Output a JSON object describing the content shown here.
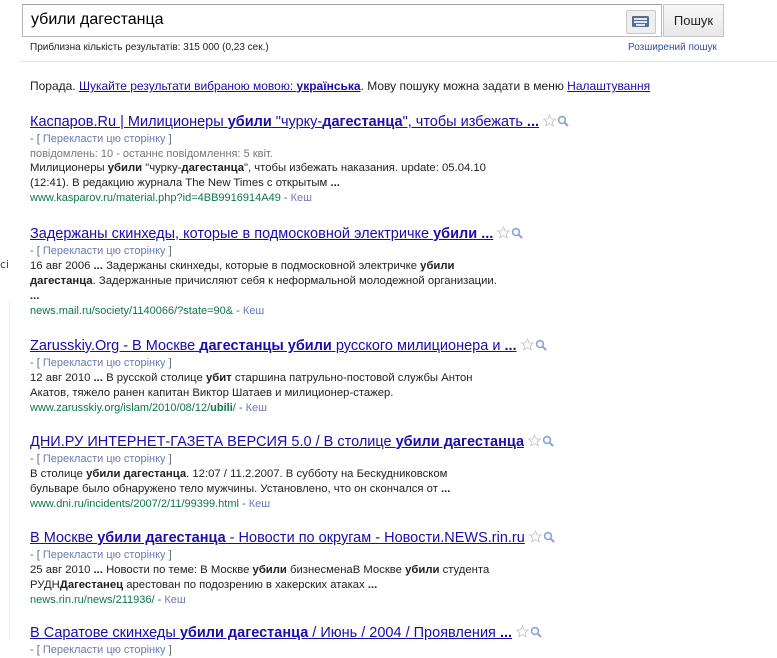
{
  "search": {
    "query": "убили дагестанца",
    "button_label": "Пошук",
    "stats": "Приблизна кількість результатів: 315 000 (0,23 сек.)",
    "advanced_link": "Розширений пошук"
  },
  "tip": {
    "prefix": "Порада. ",
    "link_text": "Шукайте результати вибраною мовою: ",
    "link_lang": "українська",
    "middle": ". Мову пошуку можна задати в меню ",
    "settings_link": "Налаштування"
  },
  "side_glyph": "ci",
  "translate_label": "Перекласти цю сторінку",
  "cache_label": "Кеш",
  "results": [
    {
      "title": [
        {
          "t": "Каспаров.Ru | Милиционеры ",
          "b": false
        },
        {
          "t": "убили",
          "b": true
        },
        {
          "t": " \"чурку-",
          "b": false
        },
        {
          "t": "дагестанца",
          "b": true
        },
        {
          "t": "\", чтобы избежать ",
          "b": false
        },
        {
          "t": "...",
          "b": true
        }
      ],
      "meta": "повідомлень: 10 - останнє повідомлення: 5 квіт.",
      "snippet": [
        [
          {
            "t": "Милиционеры ",
            "b": false
          },
          {
            "t": "убили",
            "b": true
          },
          {
            "t": " \"чурку-",
            "b": false
          },
          {
            "t": "дагестанца",
            "b": true
          },
          {
            "t": "\", чтобы избежать наказания. update: 05.04.10",
            "b": false
          }
        ],
        [
          {
            "t": "(12:41). В редакцию журнала The New Times с открытым ",
            "b": false
          },
          {
            "t": "...",
            "b": true
          }
        ]
      ],
      "url": [
        {
          "t": "www.kasparov.ru/material.php?id=4BB9916914A49",
          "b": false
        }
      ]
    },
    {
      "title": [
        {
          "t": "Задержаны скинхеды, которые в подмосковной электричке ",
          "b": false
        },
        {
          "t": "убили ...",
          "b": true
        }
      ],
      "meta": "",
      "snippet": [
        [
          {
            "t": "16 авг 2006 ",
            "b": false
          },
          {
            "t": "...",
            "b": true
          },
          {
            "t": " Задержаны скинхеды, которые в подмосковной электричке ",
            "b": false
          },
          {
            "t": "убили",
            "b": true
          }
        ],
        [
          {
            "t": "дагестанца",
            "b": true
          },
          {
            "t": ". Задержанные причисляют себя к неформальной молодежной организации.",
            "b": false
          }
        ],
        [
          {
            "t": "...",
            "b": true
          }
        ]
      ],
      "url": [
        {
          "t": "news.mail.ru/society/1140066/?state=90&",
          "b": false
        }
      ]
    },
    {
      "title": [
        {
          "t": "Zarusskiy.Org - В Москве ",
          "b": false
        },
        {
          "t": "дагестанцы убили",
          "b": true
        },
        {
          "t": " русского милиционера и ",
          "b": false
        },
        {
          "t": "...",
          "b": true
        }
      ],
      "meta": "",
      "snippet": [
        [
          {
            "t": "12 авг 2010 ",
            "b": false
          },
          {
            "t": "...",
            "b": true
          },
          {
            "t": " В русской столице ",
            "b": false
          },
          {
            "t": "убит",
            "b": true
          },
          {
            "t": " старшина патрульно-постовой службы Антон",
            "b": false
          }
        ],
        [
          {
            "t": "Акатов, тяжело ранен капитан Виктор Шатаев и милиционер-стажер.",
            "b": false
          }
        ]
      ],
      "url": [
        {
          "t": "www.zarusskiy.org/islam/2010/08/12/",
          "b": false
        },
        {
          "t": "ubili",
          "b": true
        },
        {
          "t": "/",
          "b": false
        }
      ]
    },
    {
      "title": [
        {
          "t": "ДНИ.РУ ИНТЕРНЕТ-ГАЗЕТА ВЕРСИЯ 5.0 / В столице ",
          "b": false
        },
        {
          "t": "убили дагестанца",
          "b": true
        }
      ],
      "meta": "",
      "snippet": [
        [
          {
            "t": "В столице ",
            "b": false
          },
          {
            "t": "убили дагестанца",
            "b": true
          },
          {
            "t": ". 12:07 / 11.2.2007. В субботу на Бескудниковском",
            "b": false
          }
        ],
        [
          {
            "t": "бульваре было обнаружено тело мужчины. Установлено, что он скончался от ",
            "b": false
          },
          {
            "t": "...",
            "b": true
          }
        ]
      ],
      "url": [
        {
          "t": "www.dni.ru/incidents/2007/2/11/99399.html",
          "b": false
        }
      ]
    },
    {
      "title": [
        {
          "t": "В Москве ",
          "b": false
        },
        {
          "t": "убили дагестанца",
          "b": true
        },
        {
          "t": " - Новости по округам - Новости.NEWS.rin.ru",
          "b": false
        }
      ],
      "meta": "",
      "snippet": [
        [
          {
            "t": "25 авг 2010 ",
            "b": false
          },
          {
            "t": "...",
            "b": true
          },
          {
            "t": " Новости по теме: В Москве ",
            "b": false
          },
          {
            "t": "убили",
            "b": true
          },
          {
            "t": " бизнесменаВ Москве ",
            "b": false
          },
          {
            "t": "убили",
            "b": true
          },
          {
            "t": " студента",
            "b": false
          }
        ],
        [
          {
            "t": "РУДН",
            "b": false
          },
          {
            "t": "Дагестанец",
            "b": true
          },
          {
            "t": " арестован по подозрению в хакерских атаках ",
            "b": false
          },
          {
            "t": "...",
            "b": true
          }
        ]
      ],
      "url": [
        {
          "t": "news.rin.ru/news/211936/",
          "b": false
        }
      ]
    },
    {
      "title": [
        {
          "t": "В Саратове скинхеды ",
          "b": false
        },
        {
          "t": "убили дагестанца",
          "b": true
        },
        {
          "t": " / Июнь / 2004 / Проявления ",
          "b": false
        },
        {
          "t": "...",
          "b": true
        }
      ],
      "meta": "",
      "snippet": [],
      "url": []
    }
  ]
}
